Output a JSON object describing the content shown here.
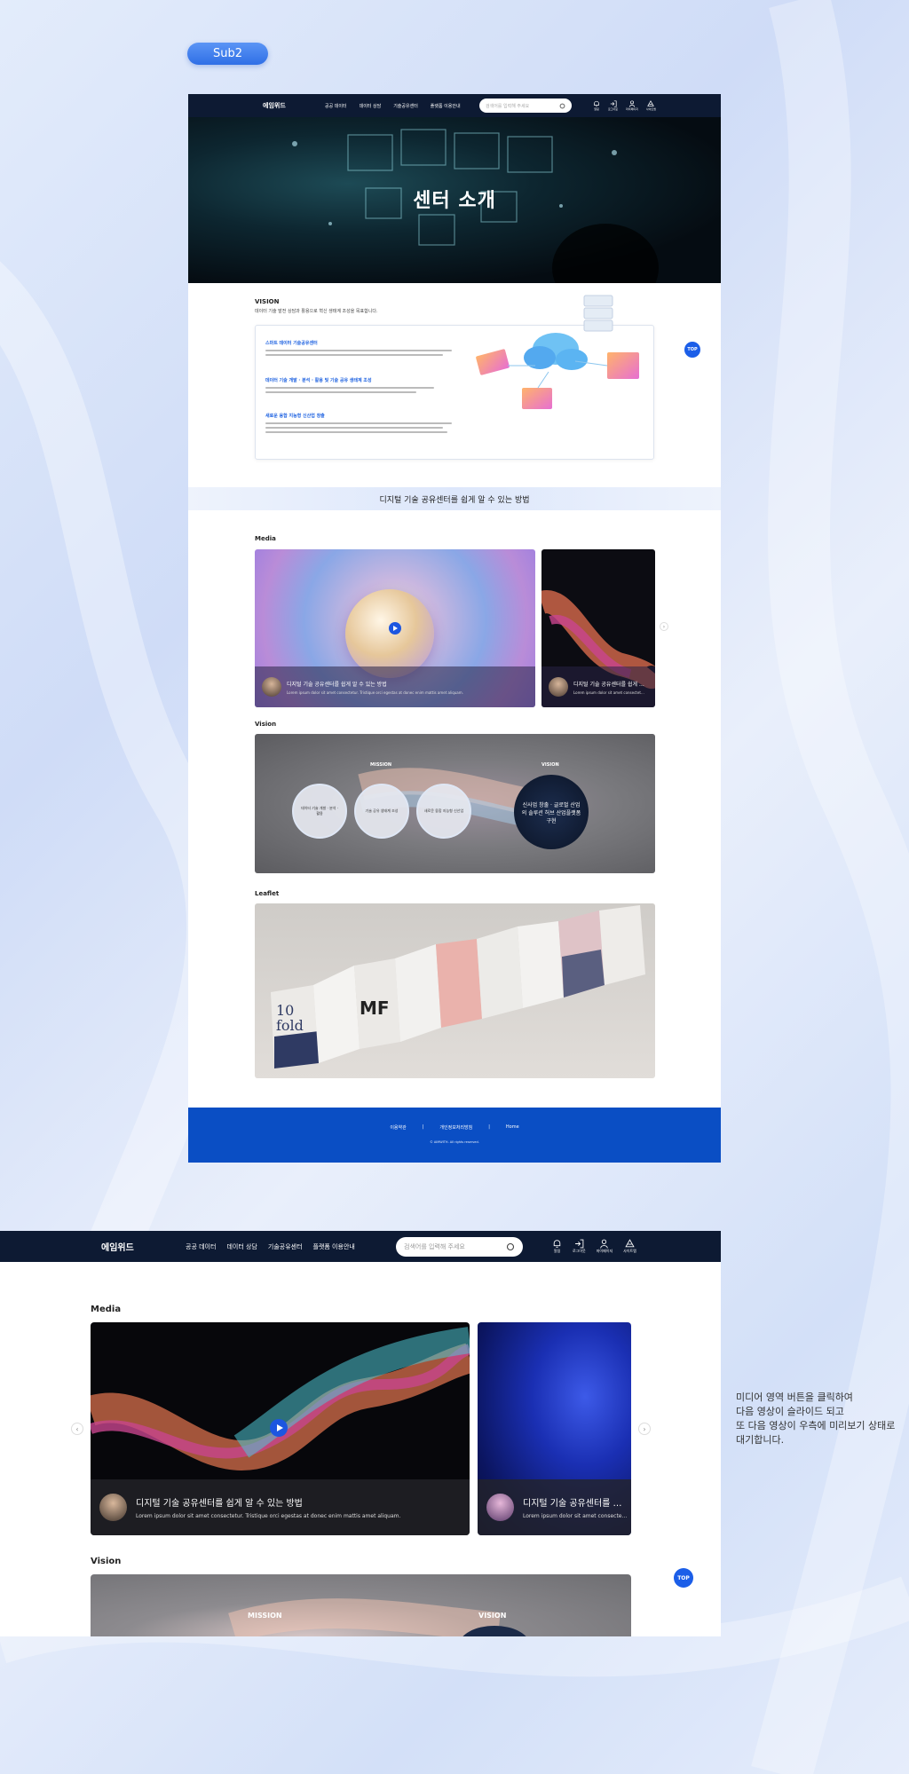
{
  "badge": "Sub2",
  "nav": {
    "logo": "에임위드",
    "menu": [
      "공공 데이터",
      "데이터 상담",
      "기술공유센터",
      "플랫폼 이용안내"
    ],
    "search_placeholder": "검색어를 입력해 주세요",
    "icons": [
      {
        "icon": "bell-icon",
        "label": "알림"
      },
      {
        "icon": "logout-icon",
        "label": "로그아웃"
      },
      {
        "icon": "user-icon",
        "label": "마이페이지"
      },
      {
        "icon": "sitemap-icon",
        "label": "사이트맵"
      }
    ]
  },
  "hero": {
    "title": "센터 소개"
  },
  "vision": {
    "label": "VISION",
    "desc": "데이터 기술 발전 상담과 활용으로 혁신 생태계 조성을 목표합니다.",
    "items": [
      {
        "title": "스마트 데이터 기술공유센터"
      },
      {
        "title": "데이터 기술 개발 · 분석 · 활용 및 기술 공유 생태계 조성"
      },
      {
        "title": "새로운 융합 지능형 신산업 창출"
      }
    ]
  },
  "top_label": "TOP",
  "band_title": "디지털 기술 공유센터를 쉽게 알 수 있는 방법",
  "sections": {
    "media": "Media",
    "vision": "Vision",
    "leaflet": "Leaflet"
  },
  "media_cards": [
    {
      "title": "디지털 기술 공유센터를 쉽게 알 수 있는 방법",
      "subtitle": "Lorem ipsum dolor sit amet consectetur. Tristique orci egestas at donec enim mattis amet aliquam."
    },
    {
      "title": "디지털 기술 공유센터를 쉽게 알 수 있는 방법",
      "subtitle": "Lorem ipsum dolor sit amet consectetur."
    }
  ],
  "vision_chart": {
    "mission_label": "MISSION",
    "vision_label": "VISION",
    "circles": [
      "데이터 기술 개발 · 분석 · 활용",
      "기술 공유 생태계 조성",
      "새로운 융합 지능형 신산업"
    ],
    "big_circle": "신사업 창출 · 글로벌 산업의 솔루션 허브 산업플랫폼 구현"
  },
  "leaflet": {
    "fold_label": "10 fold",
    "logo_text": "MF"
  },
  "footer": {
    "links": [
      "이용약관",
      "개인정보처리방침",
      "Home"
    ],
    "copyright": "© AIMWITH. All rights reserved."
  },
  "note_lines": [
    "미디어 영역 버튼을 클릭하여",
    "다음 영상이 슬라이드 되고",
    "또 다음 영상이 우측에 미리보기 상태로",
    "대기합니다."
  ],
  "colors": {
    "primary": "#1B5EE8",
    "nav": "#0D1A33",
    "footer": "#0A4EC4"
  }
}
